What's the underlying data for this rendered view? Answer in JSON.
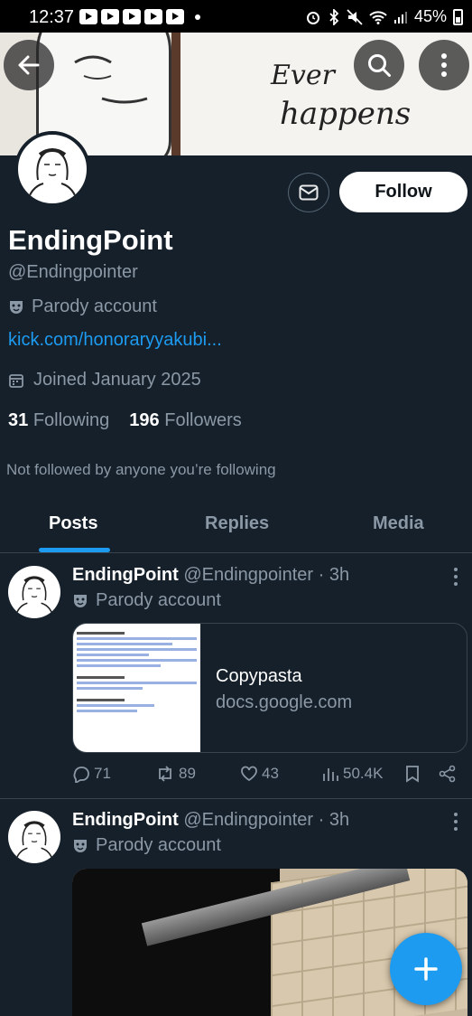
{
  "status_bar": {
    "time": "12:37",
    "battery": "45%"
  },
  "banner": {
    "text_line1": "Ever",
    "text_line2": "happens"
  },
  "profile": {
    "display_name": "EndingPoint",
    "handle": "@Endingpointer",
    "label": "Parody account",
    "link": "kick.com/honoraryyakubi...",
    "joined": "Joined January 2025",
    "following_count": "31",
    "following_label": "Following",
    "followers_count": "196",
    "followers_label": "Followers",
    "mutuals_note": "Not followed by anyone you’re following",
    "follow_label": "Follow"
  },
  "tabs": [
    {
      "label": "Posts",
      "active": true
    },
    {
      "label": "Replies",
      "active": false
    },
    {
      "label": "Media",
      "active": false
    }
  ],
  "posts": [
    {
      "name": "EndingPoint",
      "meta": "@Endingpointer · 3h",
      "label": "Parody account",
      "card": {
        "title": "Copypasta",
        "domain": "docs.google.com"
      },
      "replies": "71",
      "reposts": "89",
      "likes": "43",
      "views": "50.4K"
    },
    {
      "name": "EndingPoint",
      "meta": "@Endingpointer · 3h",
      "label": "Parody account"
    }
  ],
  "colors": {
    "background": "#15202b",
    "accent": "#1d9bf0",
    "muted": "#8b98a5"
  }
}
